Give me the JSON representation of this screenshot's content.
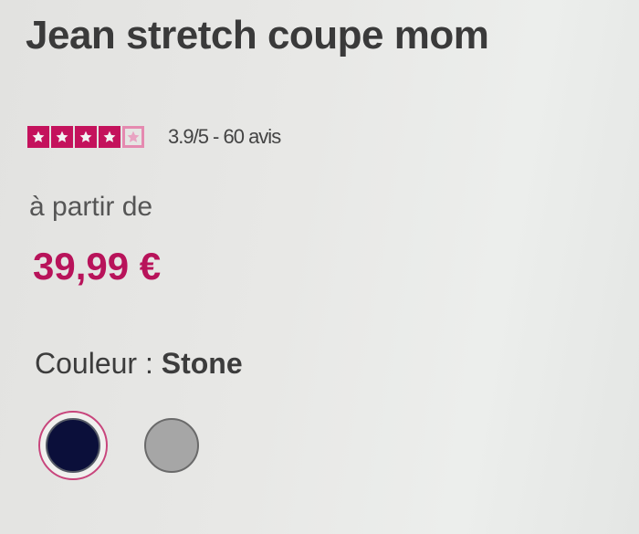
{
  "product": {
    "title": "Jean stretch coupe mom",
    "rating_text": "3.9/5 - 60 avis",
    "stars": [
      "full",
      "full",
      "full",
      "full",
      "empty"
    ],
    "from_label": "à partir de",
    "price": "39,99 €",
    "color_label": "Couleur : ",
    "color_value": "Stone"
  },
  "swatches": [
    {
      "color": "#0b0f3a",
      "selected": true
    },
    {
      "color": "#a6a6a6",
      "selected": false
    }
  ],
  "colors": {
    "accent": "#c4125c",
    "price": "#b8135a"
  }
}
